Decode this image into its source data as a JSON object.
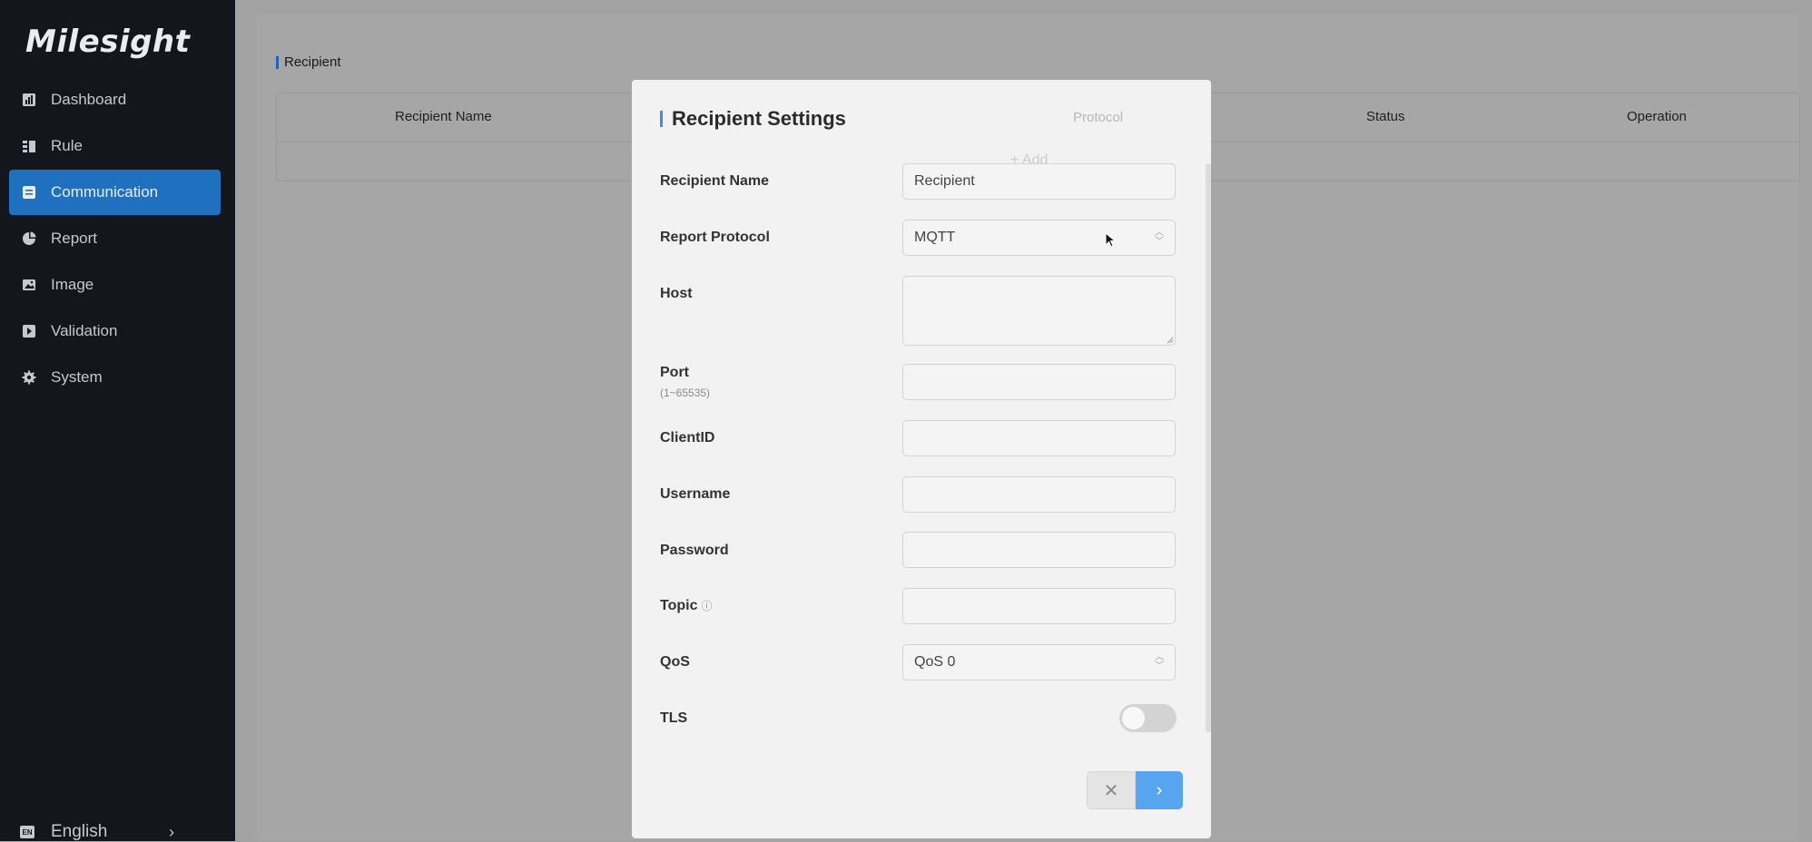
{
  "brand": {
    "logo_text": "Milesight"
  },
  "sidebar": {
    "items": [
      {
        "label": "Dashboard",
        "icon": "bar-chart-icon",
        "active": false
      },
      {
        "label": "Rule",
        "icon": "rule-list-icon",
        "active": false
      },
      {
        "label": "Communication",
        "icon": "communication-icon",
        "active": true
      },
      {
        "label": "Report",
        "icon": "pie-chart-icon",
        "active": false
      },
      {
        "label": "Image",
        "icon": "image-icon",
        "active": false
      },
      {
        "label": "Validation",
        "icon": "validation-icon",
        "active": false
      },
      {
        "label": "System",
        "icon": "gear-icon",
        "active": false
      }
    ],
    "language": {
      "badge": "EN",
      "label": "English",
      "chevron": "›"
    }
  },
  "page": {
    "breadcrumb": "Recipient",
    "table": {
      "columns": [
        "Recipient Name",
        "Protocol",
        "Status",
        "Operation"
      ],
      "add_label": "+ Add"
    }
  },
  "modal": {
    "title": "Recipient Settings",
    "fields": {
      "recipient_name": {
        "label": "Recipient Name",
        "value": "Recipient"
      },
      "report_protocol": {
        "label": "Report Protocol",
        "value": "MQTT"
      },
      "host": {
        "label": "Host",
        "value": ""
      },
      "port": {
        "label": "Port",
        "hint": "(1~65535)",
        "value": ""
      },
      "client_id": {
        "label": "ClientID",
        "value": ""
      },
      "username": {
        "label": "Username",
        "value": ""
      },
      "password": {
        "label": "Password",
        "value": ""
      },
      "topic": {
        "label": "Topic",
        "info": "ⓘ",
        "value": ""
      },
      "qos": {
        "label": "QoS",
        "value": "QoS 0"
      },
      "tls": {
        "label": "TLS",
        "enabled": false
      }
    },
    "buttons": {
      "cancel": "✕",
      "next": "›"
    }
  },
  "colors": {
    "sidebar_bg": "#13171d",
    "active_nav": "#1f71c0",
    "accent": "#3d8de0",
    "next_button": "#57a4ef"
  }
}
